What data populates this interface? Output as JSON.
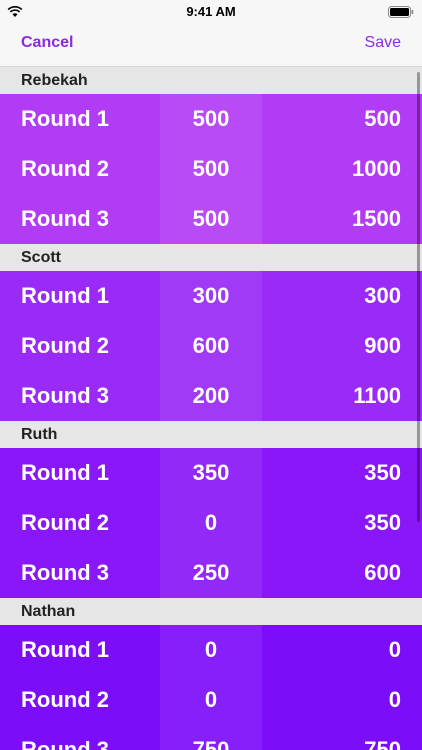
{
  "status_bar": {
    "time": "9:41 AM"
  },
  "nav": {
    "cancel_label": "Cancel",
    "save_label": "Save"
  },
  "players": [
    {
      "name": "Rebekah",
      "rounds": [
        {
          "label": "Round 1",
          "score": "500",
          "total": "500"
        },
        {
          "label": "Round 2",
          "score": "500",
          "total": "1000"
        },
        {
          "label": "Round 3",
          "score": "500",
          "total": "1500"
        }
      ]
    },
    {
      "name": "Scott",
      "rounds": [
        {
          "label": "Round 1",
          "score": "300",
          "total": "300"
        },
        {
          "label": "Round 2",
          "score": "600",
          "total": "900"
        },
        {
          "label": "Round 3",
          "score": "200",
          "total": "1100"
        }
      ]
    },
    {
      "name": "Ruth",
      "rounds": [
        {
          "label": "Round 1",
          "score": "350",
          "total": "350"
        },
        {
          "label": "Round 2",
          "score": "0",
          "total": "350"
        },
        {
          "label": "Round 3",
          "score": "250",
          "total": "600"
        }
      ]
    },
    {
      "name": "Nathan",
      "rounds": [
        {
          "label": "Round 1",
          "score": "0",
          "total": "0"
        },
        {
          "label": "Round 2",
          "score": "0",
          "total": "0"
        },
        {
          "label": "Round 3",
          "score": "750",
          "total": "750"
        }
      ]
    }
  ],
  "colors": {
    "accent": "#8a2be2",
    "section_0": "#b23cf5",
    "section_1": "#9a2af7",
    "section_2": "#8a17f8",
    "section_3": "#7c0df9"
  }
}
